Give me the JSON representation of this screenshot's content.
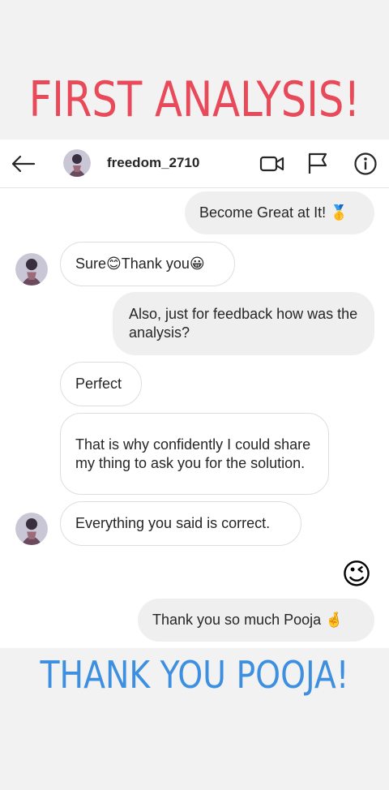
{
  "headline_top": "FIRST ANALYSIS!",
  "headline_bottom": "THANK YOU POOJA!",
  "header": {
    "username": "freedom_2710",
    "icons": [
      "back-arrow-icon",
      "video-call-icon",
      "flag-icon",
      "info-icon"
    ]
  },
  "messages": [
    {
      "direction": "out",
      "text": "Become Great at It! 🥇"
    },
    {
      "direction": "in",
      "text": "Sure😊Thank you😀"
    },
    {
      "direction": "out",
      "text": "Also,  just for feedback how was the analysis?"
    },
    {
      "direction": "in",
      "text": "Perfect"
    },
    {
      "direction": "in",
      "text": "That is why confidently I could share  my thing to ask you for the solution."
    },
    {
      "direction": "in",
      "text": "Everything you said is correct."
    },
    {
      "direction": "out",
      "text": "😉"
    },
    {
      "direction": "out",
      "text": "Thank you so much Pooja 🤞"
    }
  ],
  "colors": {
    "headline_top": "#e84a5a",
    "headline_bottom": "#3d8fe0",
    "outgoing_bubble": "#efefef",
    "incoming_border": "#dedede"
  }
}
